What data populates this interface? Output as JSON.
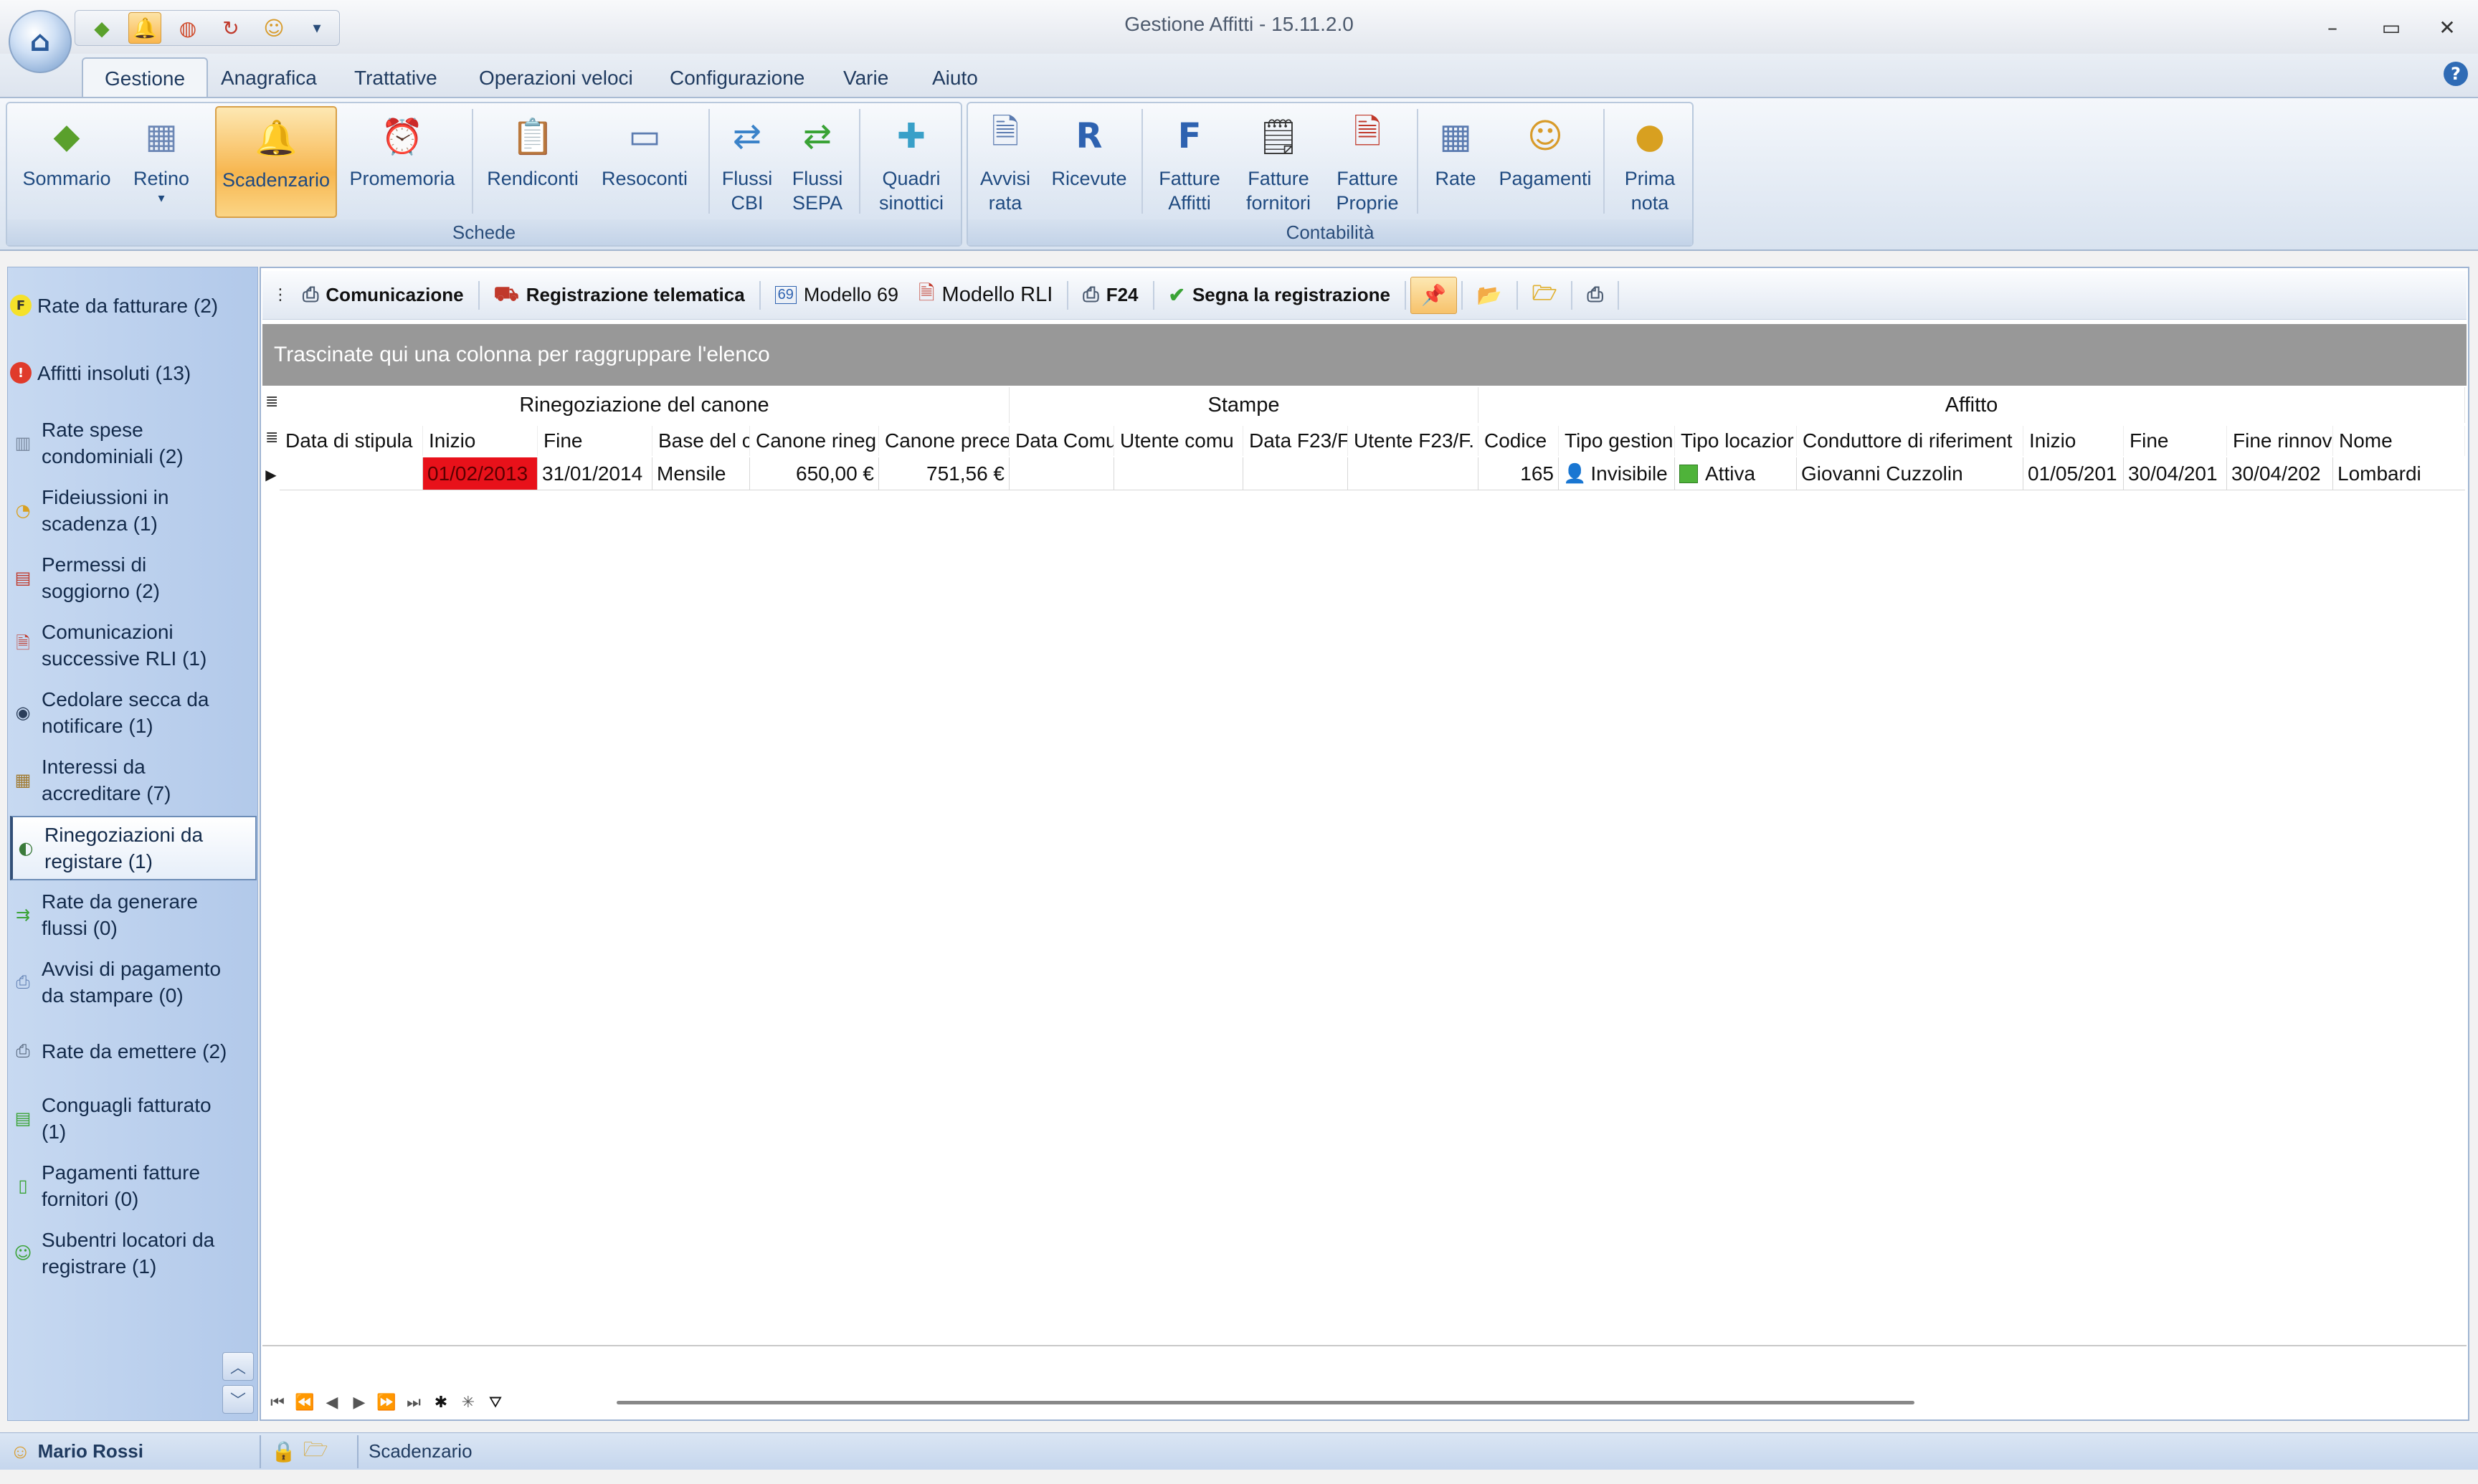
{
  "window": {
    "title": "Gestione Affitti - 15.11.2.0",
    "minimize": "–",
    "restore": "▭",
    "close": "✕"
  },
  "qat": {
    "more": "▾"
  },
  "ribbon_tabs": [
    "Gestione",
    "Anagrafica",
    "Trattative",
    "Operazioni veloci",
    "Configurazione",
    "Varie",
    "Aiuto"
  ],
  "help": "?",
  "ribbon": {
    "schede": {
      "label": "Schede",
      "buttons": [
        {
          "label": "Sommario",
          "icon": "green-diamond-icon"
        },
        {
          "label": "Retino",
          "icon": "calendar-icon",
          "dropdown": "▾"
        },
        {
          "label": "Scadenzario",
          "icon": "alarm-bell-icon"
        },
        {
          "label": "Promemoria",
          "icon": "alarm-clock-icon"
        },
        {
          "label": "Rendiconti",
          "icon": "clipboard-icon"
        },
        {
          "label": "Resoconti",
          "icon": "window-icon"
        },
        {
          "label": "Flussi\nCBI",
          "icon": "blue-arrows-icon"
        },
        {
          "label": "Flussi\nSEPA",
          "icon": "green-arrows-icon"
        },
        {
          "label": "Quadri\nsinottici",
          "icon": "puzzle-icon"
        }
      ]
    },
    "contabilita": {
      "label": "Contabilità",
      "buttons": [
        {
          "label": "Avvisi\nrata",
          "icon": "notice-icon"
        },
        {
          "label": "Ricevute",
          "icon": "receipt-icon"
        },
        {
          "label": "Fatture\nAffitti",
          "icon": "invoice-f-icon"
        },
        {
          "label": "Fatture\nfornitori",
          "icon": "invoice-lines-icon"
        },
        {
          "label": "Fatture\nProprie",
          "icon": "invoice-own-icon"
        },
        {
          "label": "Rate",
          "icon": "grid-table-icon"
        },
        {
          "label": "Pagamenti",
          "icon": "person-coins-icon"
        },
        {
          "label": "Prima\nnota",
          "icon": "gold-coin-icon"
        }
      ]
    }
  },
  "leftnav": {
    "items": [
      {
        "label": "Rate da fatturare (2)",
        "icon": "f-badge-icon"
      },
      {
        "label": "Affitti insoluti (13)",
        "icon": "red-alert-icon"
      },
      {
        "label": "Rate spese\ncondominiali (2)",
        "icon": "building-icon"
      },
      {
        "label": "Fideiussioni in\nscadenza (1)",
        "icon": "clock-coin-icon"
      },
      {
        "label": "Permessi di\nsoggiorno (2)",
        "icon": "id-card-icon"
      },
      {
        "label": "Comunicazioni\nsuccessive RLI (1)",
        "icon": "document-person-icon"
      },
      {
        "label": "Cedolare secca da\nnotificare (1)",
        "icon": "home-circle-icon"
      },
      {
        "label": "Interessi da\naccreditare (7)",
        "icon": "calculator-icon"
      },
      {
        "label": "Rinegoziazioni da\nregistare (1)",
        "icon": "negotiation-icon"
      },
      {
        "label": "Rate da generare\nflussi (0)",
        "icon": "money-flow-icon"
      },
      {
        "label": "Avvisi di pagamento\nda stampare (0)",
        "icon": "printer-notice-icon"
      },
      {
        "label": "Rate da emettere (2)",
        "icon": "printer-icon"
      },
      {
        "label": "Conguagli fatturato\n(1)",
        "icon": "balance-sheet-icon"
      },
      {
        "label": "Pagamenti fatture\nfornitori (0)",
        "icon": "trash-bin-icon"
      },
      {
        "label": "Subentri locatori da\nregistrare (1)",
        "icon": "person-swap-icon"
      }
    ],
    "scroll_up": "︿",
    "scroll_down": "﹀"
  },
  "toolbar": {
    "comunicazione": "Comunicazione",
    "registrazione": "Registrazione telematica",
    "modello69": "Modello 69",
    "modello69_badge": "69",
    "modellorli": "Modello RLI",
    "f24": "F24",
    "segna": "Segna la registrazione"
  },
  "grid": {
    "groupby_hint": "Trascinate qui una colonna per raggruppare l'elenco",
    "bands": [
      "Rinegoziazione del canone",
      "Stampe",
      "Affitto"
    ],
    "columns": [
      "Data di stipula",
      "Inizio",
      "Fine",
      "Base del c",
      "Canone rineg",
      "Canone prece",
      "Data Comu",
      "Utente comu",
      "Data F23/F",
      "Utente F23/F.",
      "Codice",
      "Tipo gestion",
      "Tipo locazior",
      "Conduttore di riferiment",
      "Inizio",
      "Fine",
      "Fine rinnov",
      "Nome"
    ],
    "rows": [
      [
        "",
        "01/02/2013",
        "31/01/2014",
        "Mensile",
        "650,00 €",
        "751,56 €",
        "",
        "",
        "",
        "",
        "165",
        "Invisibile",
        "Attiva",
        "Giovanni Cuzzolin",
        "01/05/201",
        "30/04/201",
        "30/04/202",
        "Lombardi"
      ]
    ],
    "row_indicator": "▶",
    "grip": "≣"
  },
  "navbar": [
    "⏮",
    "⏪",
    "◀",
    "▶",
    "⏩",
    "⏭",
    "✱",
    "✳",
    "⛛"
  ],
  "status": {
    "user": "Mario Rossi",
    "module": "Scadenzario"
  }
}
